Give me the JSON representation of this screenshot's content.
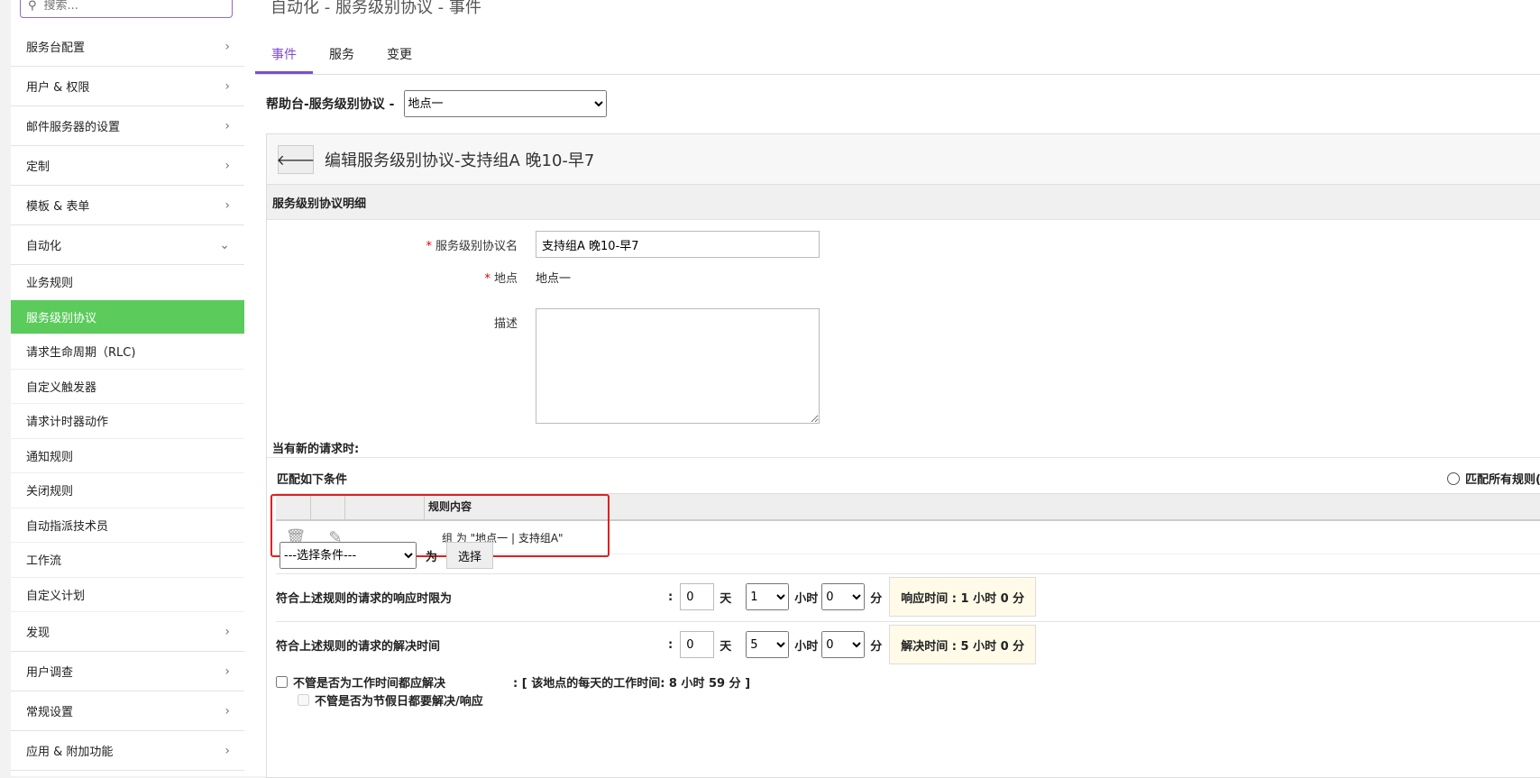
{
  "sidebar": {
    "search_placeholder": "搜索...",
    "menu_top": [
      {
        "label": "服务台配置"
      },
      {
        "label": "用户 & 权限"
      },
      {
        "label": "邮件服务器的设置"
      },
      {
        "label": "定制"
      },
      {
        "label": "模板 & 表单"
      },
      {
        "label": "自动化"
      }
    ],
    "automation_items": [
      {
        "label": "业务规则"
      },
      {
        "label": "服务级别协议"
      },
      {
        "label": "请求生命周期（RLC)"
      },
      {
        "label": "自定义触发器"
      },
      {
        "label": "请求计时器动作"
      },
      {
        "label": "通知规则"
      },
      {
        "label": "关闭规则"
      },
      {
        "label": "自动指派技术员"
      },
      {
        "label": "工作流"
      },
      {
        "label": "自定义计划"
      }
    ],
    "menu_bottom": [
      {
        "label": "发现"
      },
      {
        "label": "用户调查"
      },
      {
        "label": "常规设置"
      },
      {
        "label": "应用 & 附加功能"
      }
    ]
  },
  "breadcrumb": "自动化 - 服务级别协议 - 事件",
  "tabs": [
    {
      "label": "事件"
    },
    {
      "label": "服务"
    },
    {
      "label": "变更"
    }
  ],
  "sla_selector": {
    "label": "帮助台-服务级别协议 -",
    "value": "地点一"
  },
  "panel": {
    "title": "编辑服务级别协议-支持组A 晚10-早7",
    "section": "服务级别协议明细",
    "name_label": "服务级别协议名",
    "name_value": "支持组A 晚10-早7",
    "site_label": "地点",
    "site_value": "地点一",
    "desc_label": "描述",
    "desc_value": ""
  },
  "rules": {
    "when_new": "当有新的请求时:",
    "match_label": "匹配如下条件",
    "match_all": "匹配所有规则(",
    "col_content": "规则内容",
    "row_text": "组 为 \"地点一 | 支持组A\"",
    "condition_placeholder": "---选择条件---",
    "for_label": "为",
    "choose_button": "选择"
  },
  "response": {
    "label": "符合上述规则的请求的响应时限为",
    "days": "0",
    "day_unit": "天",
    "hours": "1",
    "hour_unit": "小时",
    "minutes": "0",
    "minute_unit": "分",
    "summary": "响应时间 : 1 小时 0 分"
  },
  "resolution": {
    "label": "符合上述规则的请求的解决时间",
    "days": "0",
    "day_unit": "天",
    "hours": "5",
    "hour_unit": "小时",
    "minutes": "0",
    "minute_unit": "分",
    "summary": "解决时间 : 5 小时 0 分"
  },
  "options": {
    "ignore_worktime": "不管是否为工作时间都应解决",
    "worktime_info": ": [ 该地点的每天的工作时间:  8 小时 59 分 ]",
    "ignore_holiday": "不管是否为节假日都要解决/响应"
  }
}
